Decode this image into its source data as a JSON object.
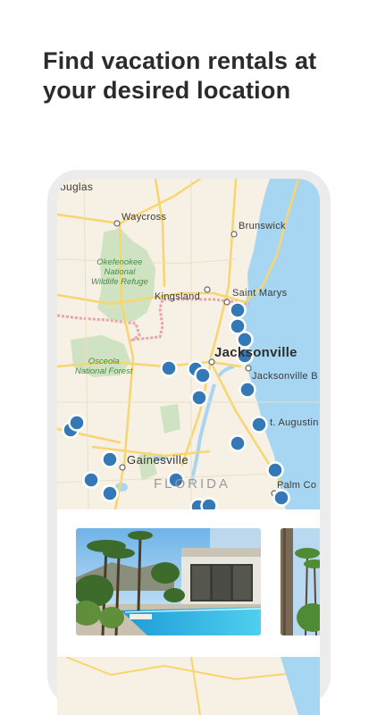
{
  "headline": "Find vacation rentals at your desired location",
  "map": {
    "labels": {
      "douglas": "ouglas",
      "waycross": "Waycross",
      "brunswick": "Brunswick",
      "okefenokee": "Okefenokee\nNational\nWildlife Refuge",
      "kingsland": "Kingsland",
      "saint_marys": "Saint Marys",
      "jacksonville": "Jacksonville",
      "jacksonville_beach": "Jacksonville B",
      "osceola": "Osceola\nNational Forest",
      "st_augustine": "t. Augustin",
      "gainesville": "Gainesville",
      "florida": "FLORIDA",
      "palm_coast": "Palm Co"
    },
    "colors": {
      "land": "#f6f1e4",
      "water": "#a7d6f2",
      "park": "#cfe3c3",
      "pin": "#3478b5",
      "road": "#f8d56f"
    }
  },
  "listing_cards": [
    {
      "image": "villa-pool-photo"
    },
    {
      "image": "palm-trees-photo"
    }
  ]
}
